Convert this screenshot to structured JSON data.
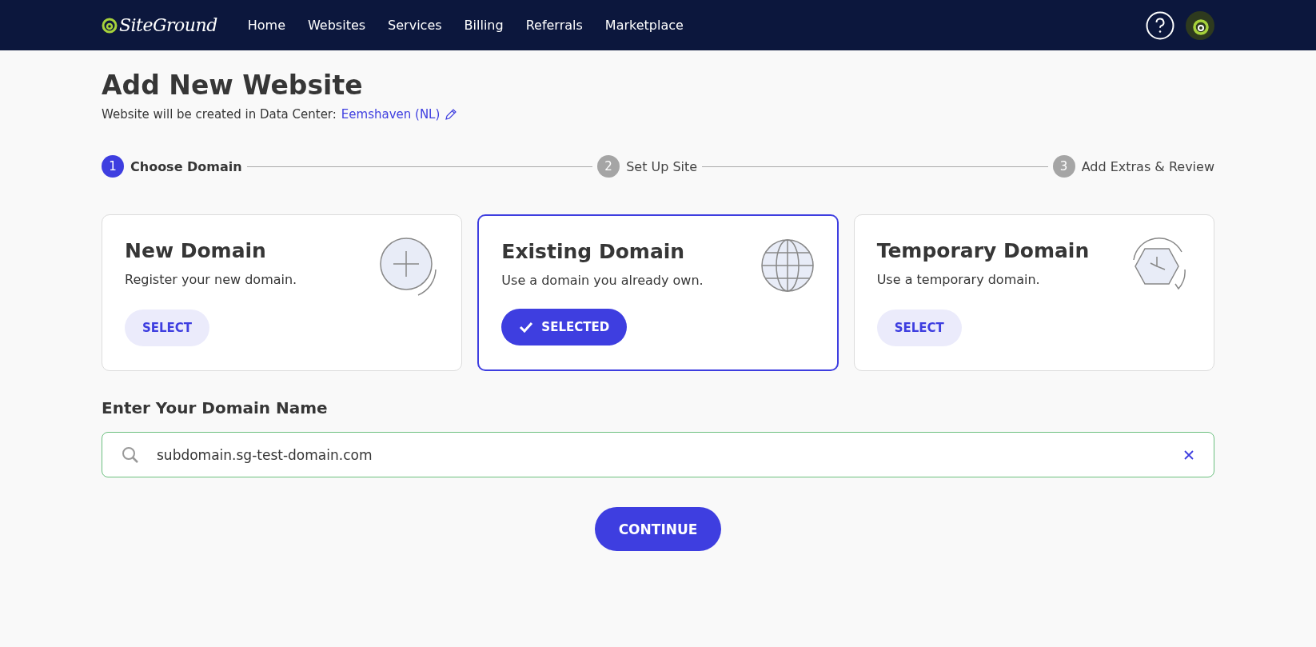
{
  "nav": {
    "logo": "SiteGround",
    "items": [
      "Home",
      "Websites",
      "Services",
      "Billing",
      "Referrals",
      "Marketplace"
    ]
  },
  "page": {
    "title": "Add New Website",
    "subtitle": "Website will be created in Data Center:",
    "data_center": "Eemshaven (NL)"
  },
  "steps": [
    {
      "number": "1",
      "label": "Choose Domain",
      "selected": true
    },
    {
      "number": "2",
      "label": "Set Up Site",
      "selected": false
    },
    {
      "number": "3",
      "label": "Add Extras & Review",
      "selected": false
    }
  ],
  "options": [
    {
      "kind": "plus",
      "title": "New Domain",
      "description": "Register your new domain.",
      "button": "SELECT",
      "selected": false
    },
    {
      "kind": "globe",
      "title": "Existing Domain",
      "description": "Use a domain you already own.",
      "button": "SELECTED",
      "selected": true
    },
    {
      "kind": "clock",
      "title": "Temporary Domain",
      "description": "Use a temporary domain.",
      "button": "SELECT",
      "selected": false
    }
  ],
  "domain_field": {
    "label": "Enter Your Domain Name",
    "value": "subdomain.sg-test-domain.com"
  },
  "continue_button": "CONTINUE"
}
